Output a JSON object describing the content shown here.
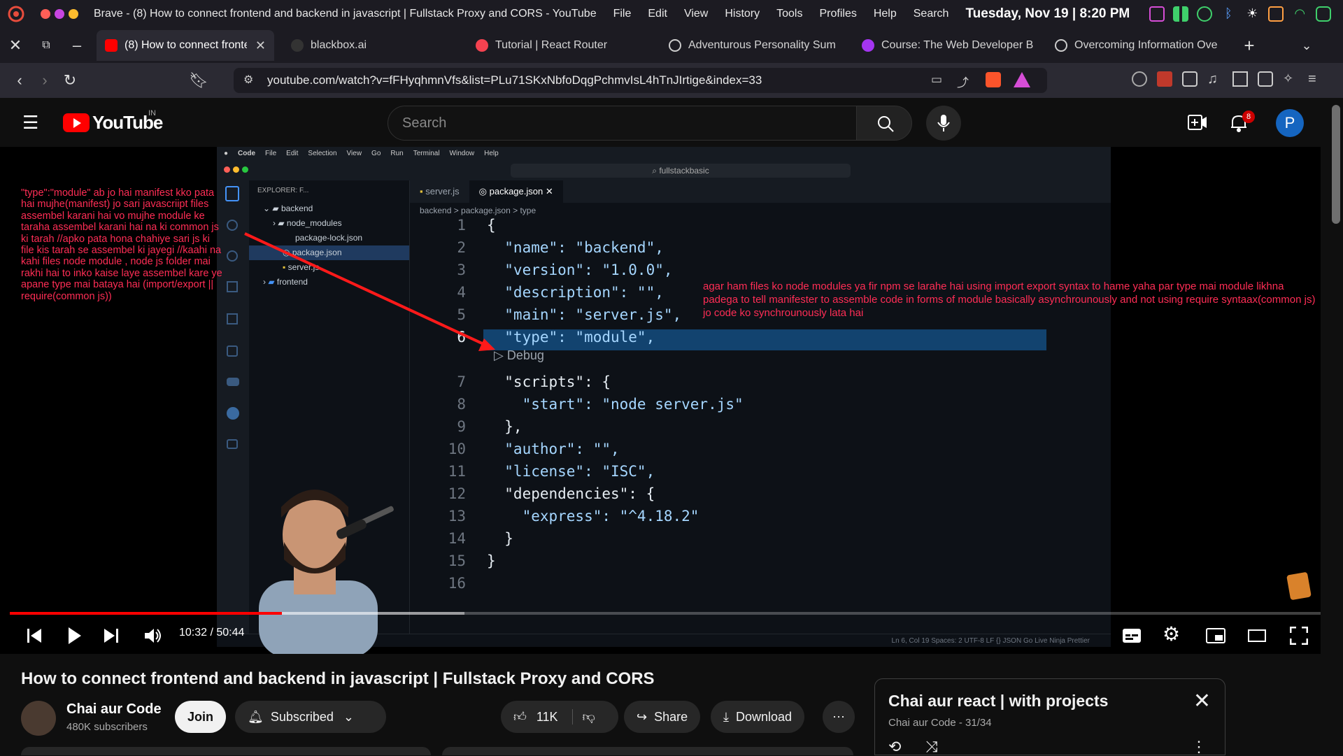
{
  "system": {
    "window_title": "Brave - (8) How to connect frontend and backend in javascript | Fullstack Proxy and CORS - YouTube",
    "menu": [
      "File",
      "Edit",
      "View",
      "History",
      "Tools",
      "Profiles",
      "Help",
      "Search"
    ],
    "datetime": "Tuesday, Nov 19 | 8:20 PM"
  },
  "tabs": [
    {
      "label": "(8) How to connect fronte",
      "active": true
    },
    {
      "label": "blackbox.ai"
    },
    {
      "label": "Tutorial | React Router"
    },
    {
      "label": "Adventurous Personality Sum"
    },
    {
      "label": "Course: The Web Developer B"
    },
    {
      "label": "Overcoming Information Ove"
    }
  ],
  "address": {
    "url": "youtube.com/watch?v=fFHyqhmnVfs&list=PLu71SKxNbfoDqgPchmvIsL4hTnJIrtige&index=33"
  },
  "youtube": {
    "logo_text": "YouTube",
    "country": "IN",
    "search_placeholder": "Search",
    "notif_count": "8",
    "avatar_letter": "P"
  },
  "vscode": {
    "menu": [
      "Code",
      "File",
      "Edit",
      "Selection",
      "View",
      "Go",
      "Run",
      "Terminal",
      "Window",
      "Help"
    ],
    "search_text": "fullstackbasic",
    "explorer_header": "EXPLORER: F...",
    "tree": [
      "backend",
      "node_modules",
      "package-lock.json",
      "package.json",
      "server.js",
      "frontend"
    ],
    "tabs": [
      "server.js",
      "package.json"
    ],
    "breadcrumb": "backend  >  package.json  >  type",
    "status": "Ln 6, Col 19    Spaces: 2    UTF-8    LF    {} JSON    Go Live    Ninja    Prettier",
    "line_numbers": [
      "1",
      "2",
      "3",
      "4",
      "5",
      "6",
      "7",
      "8",
      "9",
      "10",
      "11",
      "12",
      "13",
      "14",
      "15",
      "16"
    ],
    "code": [
      "{",
      "  \"name\": \"backend\",",
      "  \"version\": \"1.0.0\",",
      "  \"description\": \"\",",
      "  \"main\": \"server.js\",",
      "  \"type\": \"module\",",
      "  ▷ Debug",
      "  \"scripts\": {",
      "    \"start\": \"node server.js\"",
      "  },",
      "  \"author\": \"\",",
      "  \"license\": \"ISC\",",
      "  \"dependencies\": {",
      "    \"express\": \"^4.18.2\"",
      "  }",
      "}",
      ""
    ]
  },
  "annotations": {
    "left": "\"type\":\"module\" ab jo hai manifest kko pata hai mujhe(manifest) jo sari  javascriipt files assembel karani hai vo mujhe module ke taraha assembel  karani hai na ki common js ki tarah //apko pata hona chahiye sari js ki file kis tarah se assembel ki jayegi //kaahi na kahi files node module , node js folder mai rakhi hai to inko kaise laye assembel kare ye apane type mai bataya hai (import/export  || require(common js))",
    "right": "agar ham files ko node modules ya fir npm se larahe hai using import export syntax to hame yaha par type mai module likhna padega to tell manifester to assemble code in forms of module basically asynchrounously and not using require syntaax(common js) jo code ko synchrounously lata hai"
  },
  "player": {
    "time": "10:32 / 50:44",
    "progress_fraction": 0.2075,
    "buffered_fraction": 0.347
  },
  "video": {
    "title": "How to connect frontend and backend in javascript | Fullstack Proxy and CORS",
    "channel": "Chai aur Code",
    "subscribers": "480K subscribers",
    "join_label": "Join",
    "subscribed_label": "Subscribed",
    "likes": "11K",
    "share_label": "Share",
    "download_label": "Download"
  },
  "playlist": {
    "title": "Chai aur react | with projects",
    "subtitle": "Chai aur Code - 31/34"
  }
}
